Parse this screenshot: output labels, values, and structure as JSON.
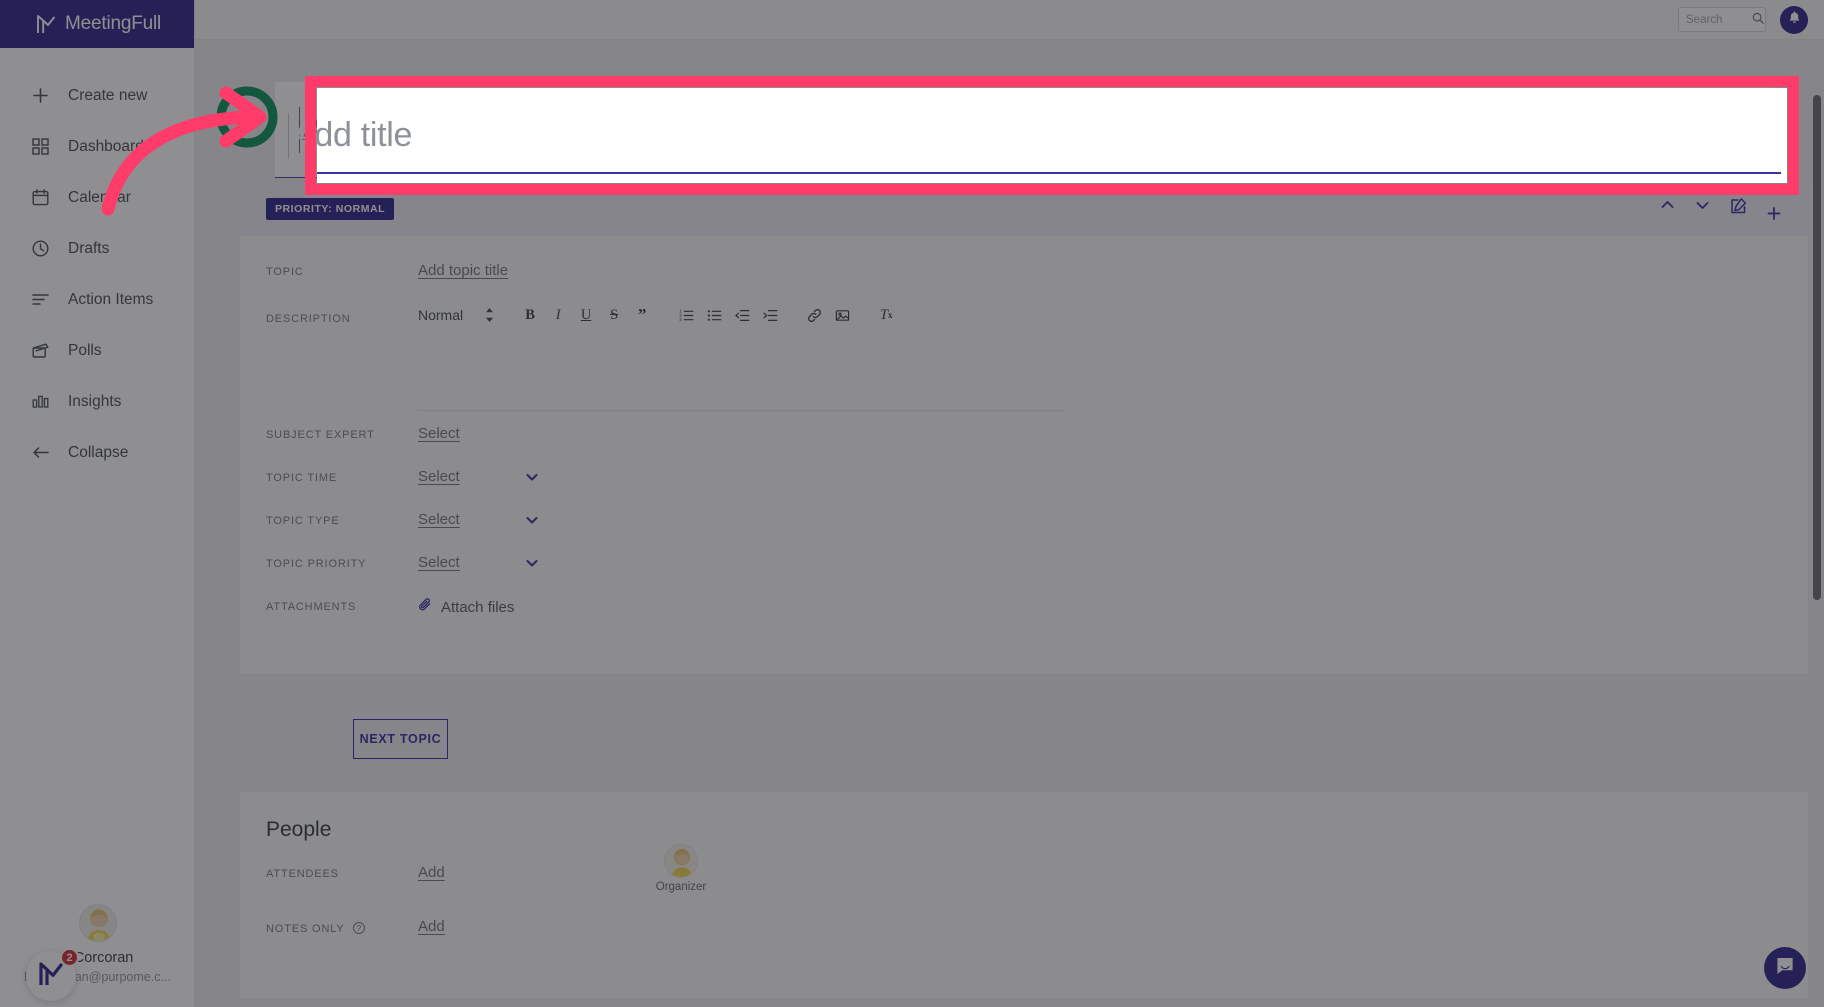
{
  "app": {
    "brand": "MeetingFull",
    "logo_icon": "meetingfull-logo-icon"
  },
  "sidebar": {
    "items": [
      {
        "label": "Create new",
        "icon": "plus-icon"
      },
      {
        "label": "Dashboard",
        "icon": "grid-icon"
      },
      {
        "label": "Calendar",
        "icon": "calendar-icon"
      },
      {
        "label": "Drafts",
        "icon": "clock-icon"
      },
      {
        "label": "Action Items",
        "icon": "list-lines-icon"
      },
      {
        "label": "Polls",
        "icon": "poll-icon"
      },
      {
        "label": "Insights",
        "icon": "bar-chart-icon"
      },
      {
        "label": "Collapse",
        "icon": "arrow-left-icon"
      }
    ],
    "user": {
      "name": "a Corcoran",
      "email": "barbar      oran@purpome.c...",
      "avatar_icon": "user-avatar",
      "notification_count": "2",
      "badge_icon": "meetingfull-badge-icon"
    }
  },
  "topbar": {
    "search": {
      "placeholder": "Search",
      "value": "",
      "icon": "search-icon"
    },
    "notifications_icon": "bell-icon"
  },
  "title_field": {
    "placeholder": "Add title",
    "value": "",
    "caret_visible": true
  },
  "meeting_card": {
    "priority_pill": "PRIORITY: NORMAL",
    "head_actions": [
      {
        "name": "move-up-button",
        "icon": "chevron-up-icon"
      },
      {
        "name": "move-down-button",
        "icon": "chevron-down-icon"
      },
      {
        "name": "edit-button",
        "icon": "edit-square-icon"
      },
      {
        "name": "add-button",
        "icon": "plus-icon"
      }
    ],
    "fields": {
      "topic": {
        "label": "TOPIC",
        "value": "Add topic title"
      },
      "description": {
        "label": "DESCRIPTION",
        "format_select": "Normal",
        "tools": [
          {
            "name": "bold-button",
            "glyph": "B"
          },
          {
            "name": "italic-button",
            "glyph": "I"
          },
          {
            "name": "underline-button",
            "glyph": "U"
          },
          {
            "name": "strikethrough-button",
            "glyph": "S"
          },
          {
            "name": "blockquote-button",
            "glyph": "”"
          },
          {
            "name": "ordered-list-button",
            "glyph": ""
          },
          {
            "name": "bullet-list-button",
            "glyph": ""
          },
          {
            "name": "outdent-button",
            "glyph": ""
          },
          {
            "name": "indent-button",
            "glyph": ""
          },
          {
            "name": "link-button",
            "glyph": ""
          },
          {
            "name": "image-button",
            "glyph": ""
          },
          {
            "name": "clear-format-button",
            "glyph": ""
          }
        ]
      },
      "subject_expert": {
        "label": "SUBJECT EXPERT",
        "value": "Select"
      },
      "topic_time": {
        "label": "TOPIC TIME",
        "value": "Select"
      },
      "topic_type": {
        "label": "TOPIC TYPE",
        "value": "Select"
      },
      "topic_priority": {
        "label": "TOPIC PRIORITY",
        "value": "Select"
      },
      "attachments": {
        "label": "ATTACHMENTS",
        "value": "Attach files",
        "icon": "paperclip-icon"
      }
    },
    "next_topic_button": "NEXT TOPIC"
  },
  "people": {
    "heading": "People",
    "attendees": {
      "label": "ATTENDEES",
      "add_label": "Add"
    },
    "notes_only": {
      "label": "NOTES ONLY",
      "add_label": "Add",
      "help_icon": "question-circle-icon"
    },
    "organizer": {
      "role": "Organizer",
      "avatar_icon": "organizer-avatar"
    }
  },
  "chat_launcher": {
    "icon": "chat-bubble-icon"
  },
  "annotation": {
    "highlight_color": "#ff3b69",
    "arrow_icon": "curved-arrow-right-icon",
    "circle_color": "#13573f"
  },
  "colors": {
    "brand_navy": "#231a87",
    "accent_indigo": "#2d24a0",
    "annotation_pink": "#ff3b69",
    "page_bg": "#ececf0"
  }
}
